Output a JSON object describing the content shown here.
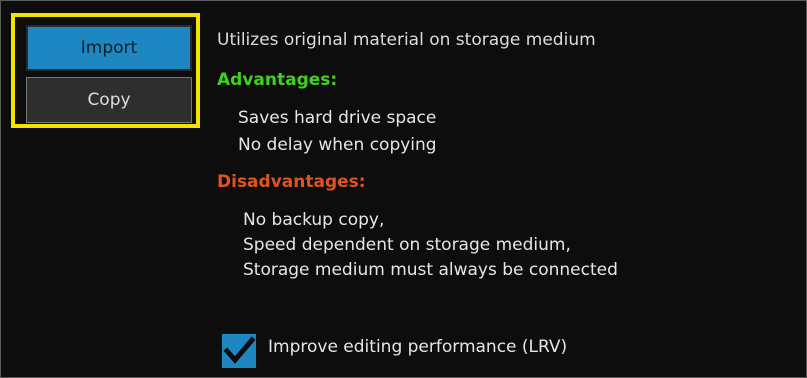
{
  "mode": {
    "import_label": "Import",
    "copy_label": "Copy",
    "selected": "Import"
  },
  "description": "Utilizes original material on storage medium",
  "advantages": {
    "heading": "Advantages:",
    "items": [
      "Saves hard drive space",
      "No delay when copying"
    ]
  },
  "disadvantages": {
    "heading": "Disadvantages:",
    "items": [
      "No backup copy,",
      "Speed dependent on storage medium,",
      "Storage medium must always be connected"
    ]
  },
  "option": {
    "label": "Improve editing performance (LRV)",
    "checked": true
  },
  "colors": {
    "accent": "#1e86c0",
    "highlight_border": "#f0e400",
    "advantages": "#3fd21c",
    "disadvantages": "#e0541a",
    "background": "#0d0d0d"
  }
}
